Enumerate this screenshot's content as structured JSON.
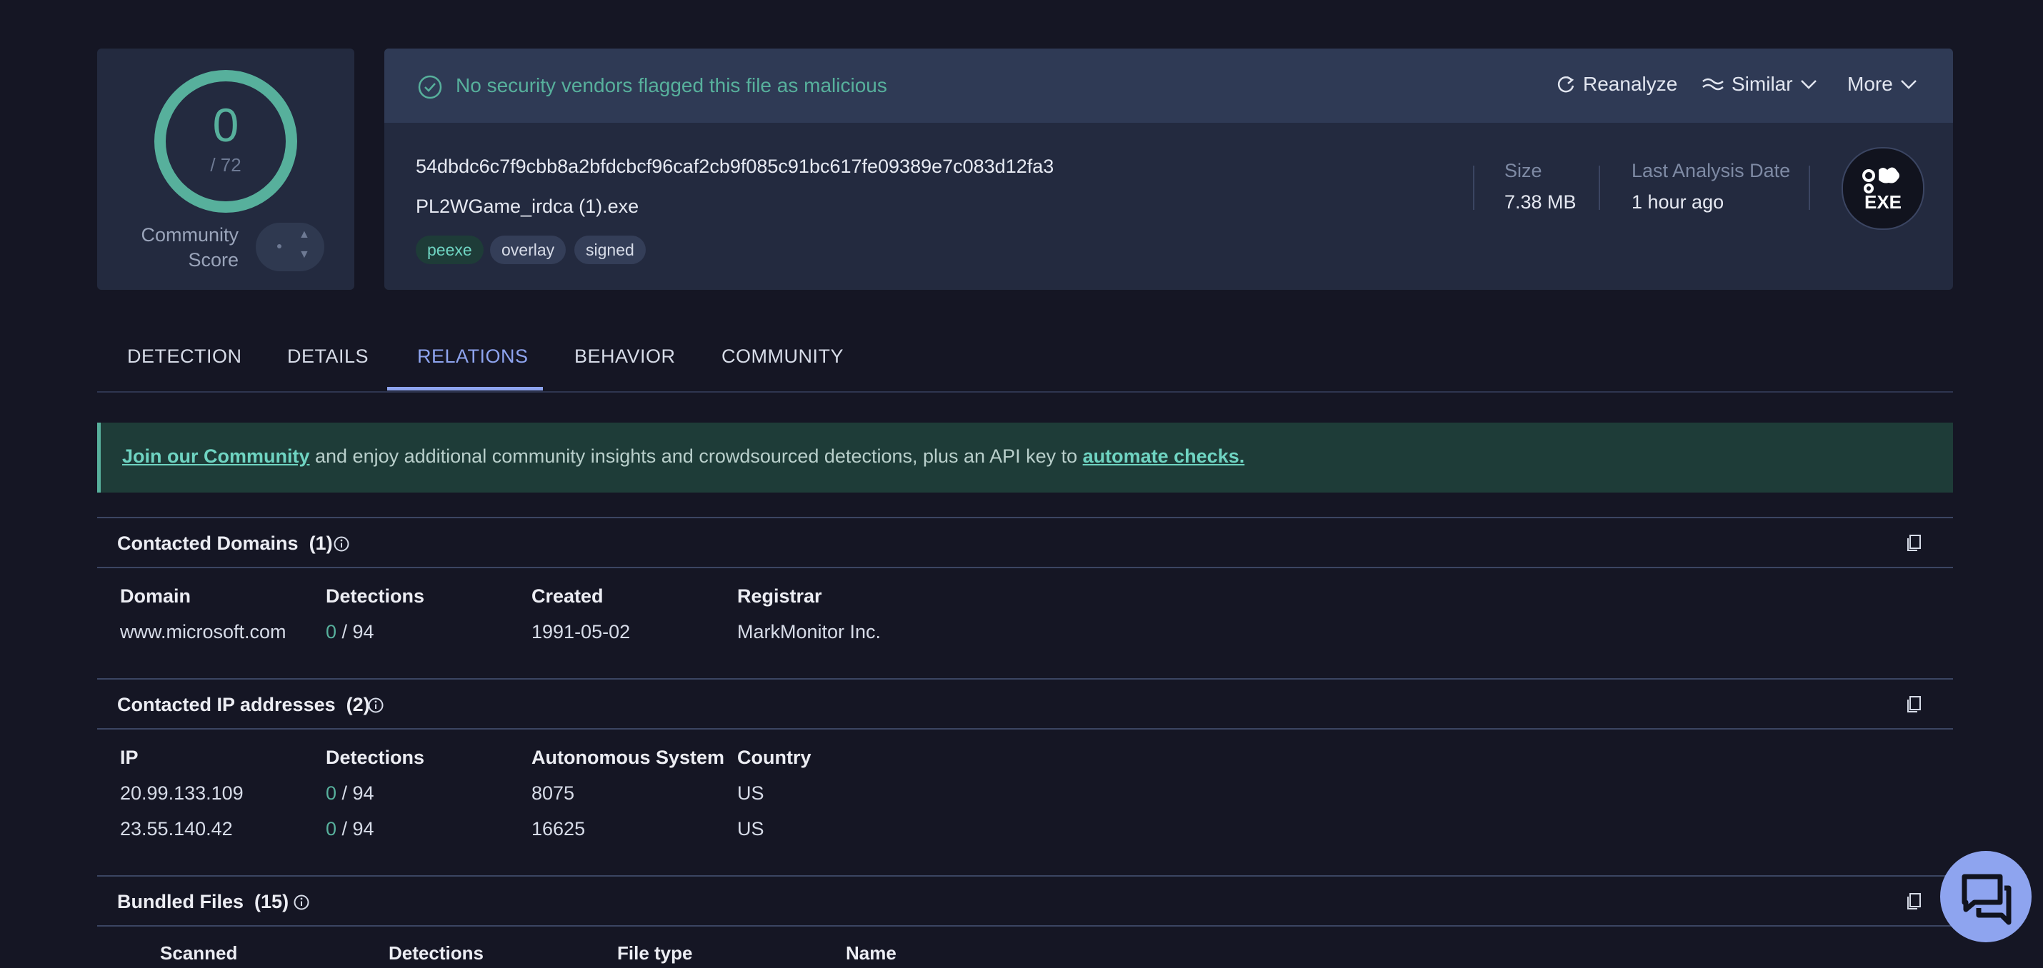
{
  "score": {
    "value": "0",
    "total": "/ 72",
    "community_label": "Community Score",
    "community_value": "-"
  },
  "status": {
    "message": "No security vendors flagged this file as malicious",
    "color": "#57b09c"
  },
  "actions": {
    "reanalyze": "Reanalyze",
    "similar": "Similar",
    "more": "More"
  },
  "file": {
    "hash": "54dbdc6c7f9cbb8a2bfdcbcf96caf2cb9f085c91bc617fe09389e7c083d12fa3",
    "name": "PL2WGame_irdca (1).exe",
    "tags": [
      "peexe",
      "overlay",
      "signed"
    ],
    "size_label": "Size",
    "size_value": "7.38 MB",
    "last_analysis_label": "Last Analysis Date",
    "last_analysis_value": "1 hour ago",
    "type_badge": "EXE"
  },
  "tabs": [
    {
      "label": "DETECTION",
      "active": false
    },
    {
      "label": "DETAILS",
      "active": false
    },
    {
      "label": "RELATIONS",
      "active": true
    },
    {
      "label": "BEHAVIOR",
      "active": false
    },
    {
      "label": "COMMUNITY",
      "active": false
    }
  ],
  "banner": {
    "link1": "Join our Community",
    "middle": " and enjoy additional community insights and crowdsourced detections, plus an API key to ",
    "link2": "automate checks."
  },
  "contacted_domains": {
    "title": "Contacted Domains",
    "count": "(1)",
    "columns": [
      "Domain",
      "Detections",
      "Created",
      "Registrar"
    ],
    "rows": [
      {
        "domain": "www.microsoft.com",
        "det_pos": "0",
        "det_total": " / 94",
        "created": "1991-05-02",
        "registrar": "MarkMonitor Inc."
      }
    ]
  },
  "contacted_ips": {
    "title": "Contacted IP addresses",
    "count": "(2)",
    "columns": [
      "IP",
      "Detections",
      "Autonomous System",
      "Country"
    ],
    "rows": [
      {
        "ip": "20.99.133.109",
        "det_pos": "0",
        "det_total": " / 94",
        "as": "8075",
        "country": "US"
      },
      {
        "ip": "23.55.140.42",
        "det_pos": "0",
        "det_total": " / 94",
        "as": "16625",
        "country": "US"
      }
    ]
  },
  "bundled_files": {
    "title": "Bundled Files",
    "count": "(15)",
    "columns": [
      "Scanned",
      "Detections",
      "File type",
      "Name"
    ]
  },
  "icons": [
    "check-circle-icon",
    "reanalyze-icon",
    "similar-icon",
    "chevron-down-icon",
    "info-icon",
    "copy-icon",
    "exe-file-icon",
    "chat-icon"
  ],
  "colors": {
    "accent": "#8ea4ef",
    "ok": "#57b09c",
    "background": "#151624",
    "card": "#232a3f"
  }
}
